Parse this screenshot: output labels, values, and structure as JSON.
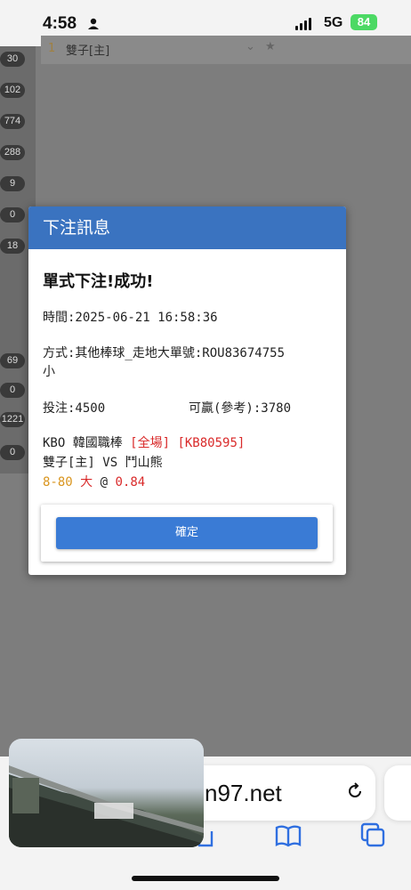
{
  "status": {
    "time": "4:58",
    "network": "5G",
    "battery": "84"
  },
  "background": {
    "row_number": "1",
    "row_team": "雙子[主]",
    "left_counts": [
      "30",
      "102",
      "774",
      "288",
      "9",
      "0",
      "18",
      "69",
      "0",
      "1221",
      "0"
    ]
  },
  "modal": {
    "title": "下注訊息",
    "heading": "單式下注!成功!",
    "time_line": "時間:2025-06-21 16:58:36",
    "method_line1": "方式:其他棒球_走地大單號:ROU83674755",
    "method_line2": "小",
    "stake": "投注:4500",
    "win": "可贏(參考):3780",
    "league": "KBO 韓國職棒",
    "period": "[全場]",
    "code": "[KB80595]",
    "teams": "雙子[主] VS 鬥山熊",
    "score": "8-80",
    "pick": "大",
    "at": "@",
    "odds": "0.84",
    "confirm_label": "確定"
  },
  "browser": {
    "url_partial": "n97.net"
  },
  "colors": {
    "header_blue": "#3a73c0",
    "button_blue": "#3a7bd5",
    "accent_red": "#d92a2a",
    "accent_orange": "#d9951f"
  }
}
